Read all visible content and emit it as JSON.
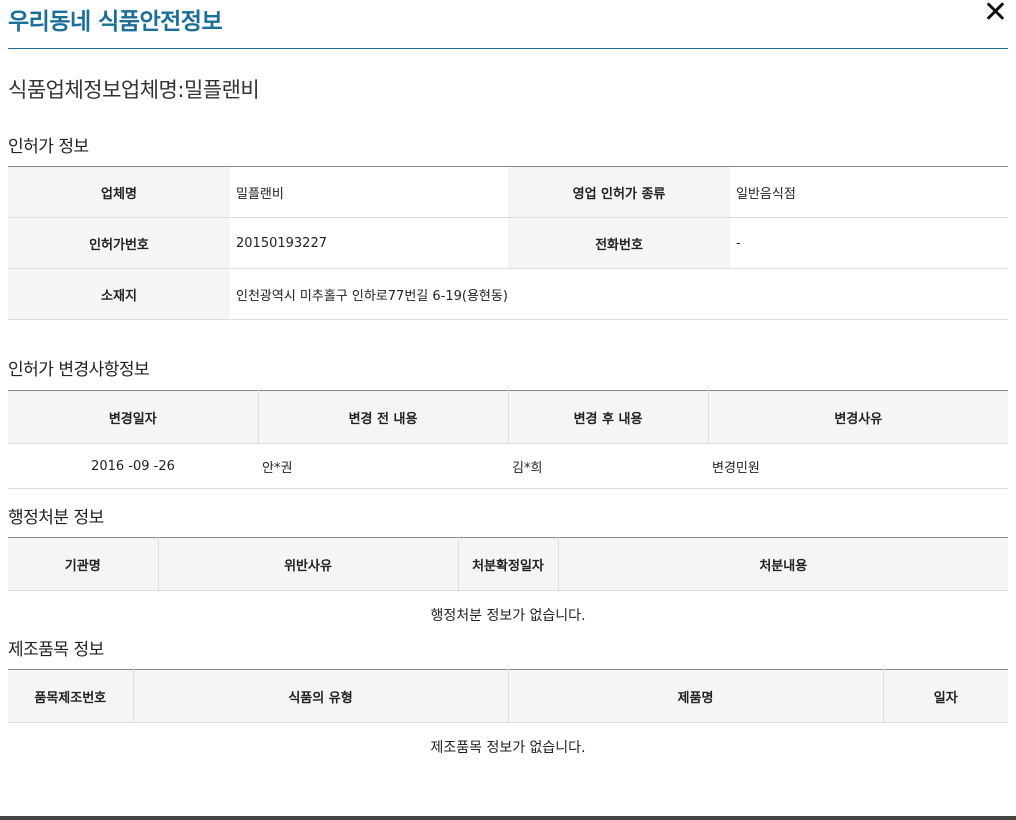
{
  "header": {
    "title": "우리동네 식품안전정보",
    "close": "✕"
  },
  "subtitle": "식품업체정보업체명:밀플랜비",
  "license": {
    "section_title": "인허가 정보",
    "company_name_label": "업체명",
    "company_name_value": "밀플랜비",
    "business_type_label": "영업 인허가 종류",
    "business_type_value": "일반음식점",
    "license_no_label": "인허가번호",
    "license_no_value": "20150193227",
    "phone_label": "전화번호",
    "phone_value": "-",
    "address_label": "소재지",
    "address_value": "인천광역시 미추홀구 인하로77번길 6-19(용현동)"
  },
  "changes": {
    "section_title": "인허가 변경사항정보",
    "headers": [
      "변경일자",
      "변경 전 내용",
      "변경 후 내용",
      "변경사유"
    ],
    "rows": [
      [
        "2016 -09 -26",
        "안*권",
        "김*희",
        "변경민원"
      ]
    ]
  },
  "admin": {
    "section_title": "행정처분 정보",
    "headers": [
      "기관명",
      "위반사유",
      "처분확정일자",
      "처분내용"
    ],
    "empty": "행정처분 정보가 없습니다."
  },
  "products": {
    "section_title": "제조품목 정보",
    "headers": [
      "품목제조번호",
      "식품의 유형",
      "제품명",
      "일자"
    ],
    "empty": "제조품목 정보가 없습니다."
  }
}
